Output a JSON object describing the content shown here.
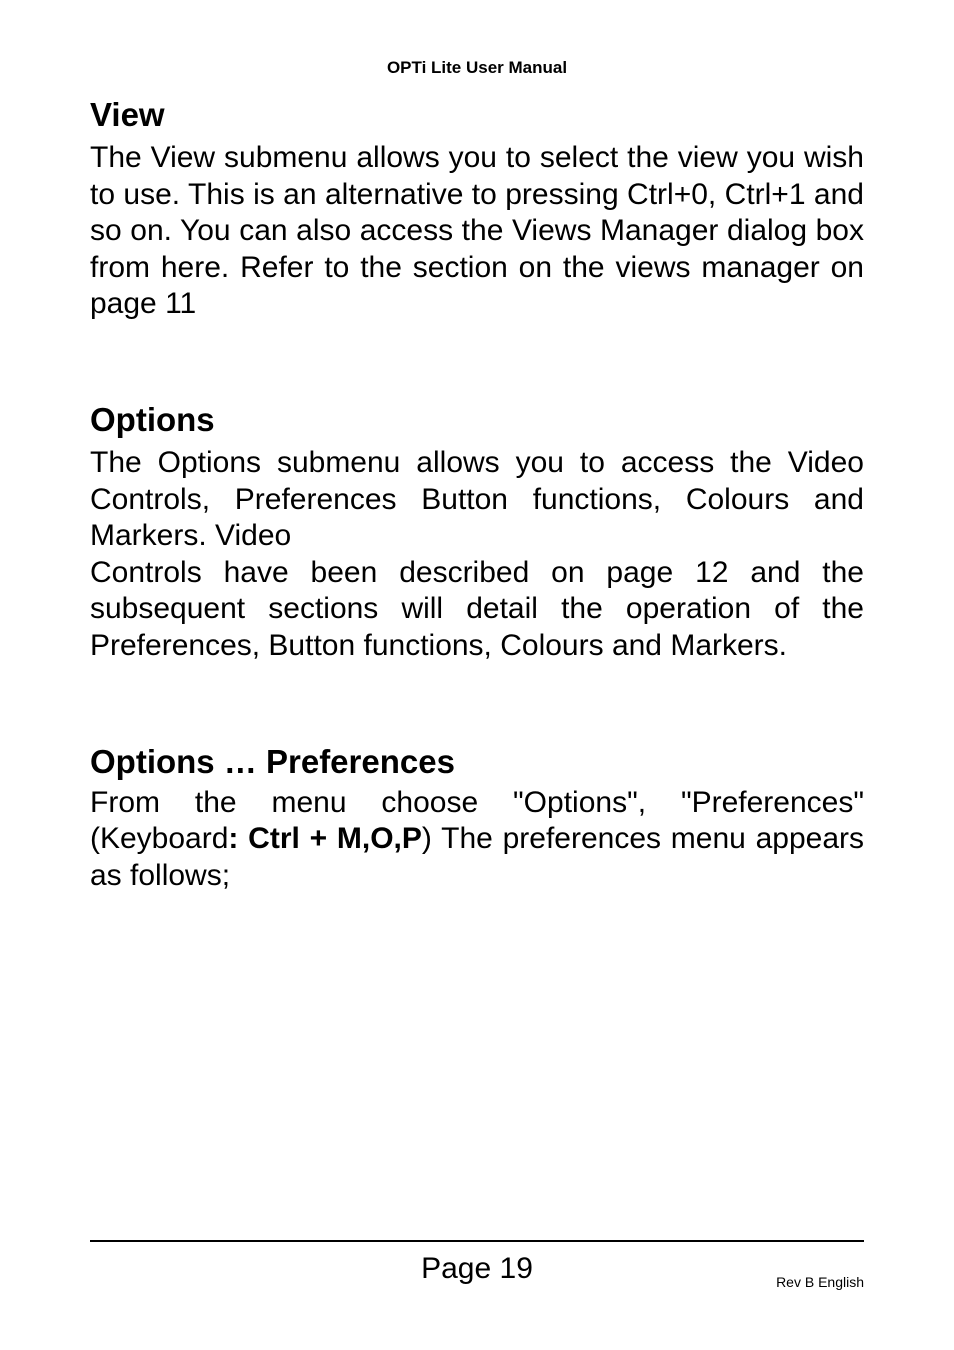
{
  "header": {
    "title": "OPTi Lite User Manual"
  },
  "section_view": {
    "heading": "View",
    "paragraph": "The View submenu allows you to select the view you wish to use. This is an alternative to pressing Ctrl+0, Ctrl+1 and so on. You can also access the Views Manager dialog box from here.  Refer to the section on the views manager on page 11"
  },
  "section_options": {
    "heading": "Options",
    "paragraph_a": "The Options submenu allows you to access the Video Controls, Preferences Button functions, Colours and Markers.  Video",
    "paragraph_b": "Controls have been described on page 12 and the subsequent sections will detail the operation of the Preferences, Button functions, Colours and Markers."
  },
  "section_optpref": {
    "heading": "Options … Preferences",
    "line1_a": "From the menu choose \"Options\", \"Preferences\" (Keyboard",
    "line1_bold": ": Ctrl + M,O,P",
    "line1_b": ") The preferences menu appears as follows;"
  },
  "footer": {
    "page_label": "Page 19",
    "rev": "Rev B English"
  }
}
